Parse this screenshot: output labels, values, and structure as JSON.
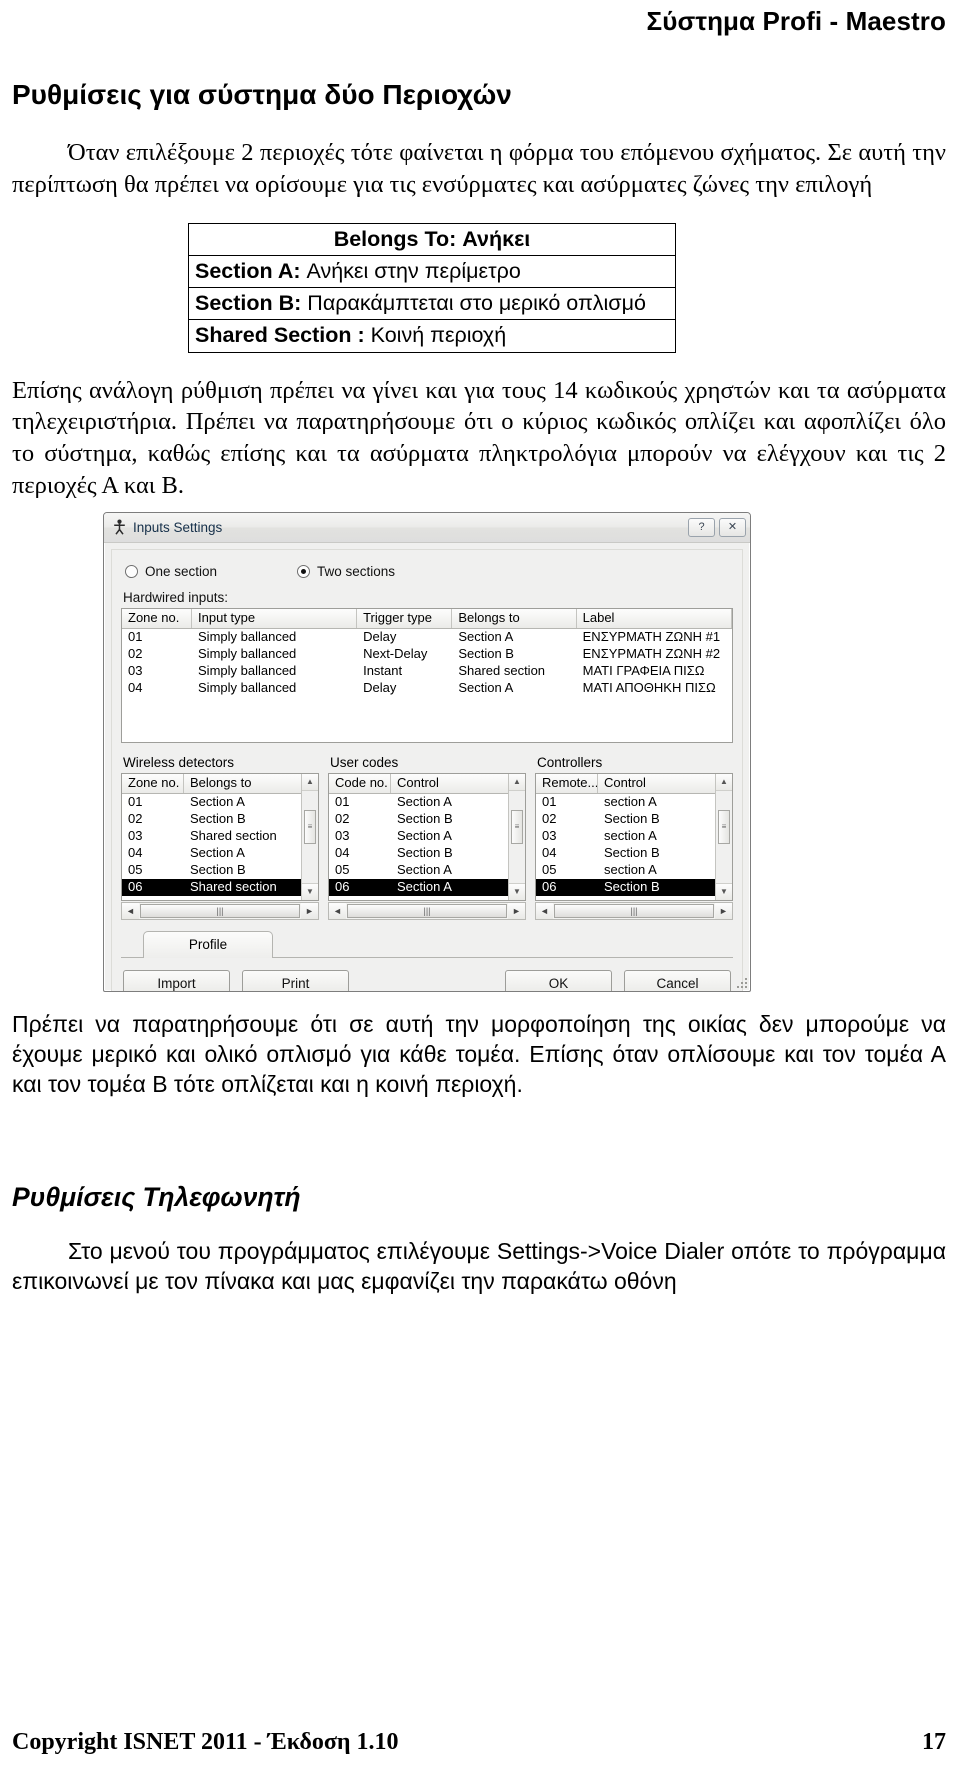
{
  "header": {
    "running_title": "Σύστημα Profi - Maestro"
  },
  "headings": {
    "h1": "Ρυθμίσεις για σύστημα δύο Περιοχών",
    "h2": "Ρυθμίσεις Τηλεφωνητή"
  },
  "paragraphs": {
    "intro": "Όταν  επιλέξουμε 2 περιοχές τότε φαίνεται η φόρμα του επόμενου σχήματος. Σε αυτή την περίπτωση θα πρέπει να ορίσουμε για τις ενσύρματες και ασύρματες ζώνες την επιλογή",
    "after_box": "Επίσης ανάλογη ρύθμιση πρέπει να γίνει και για τους 14 κωδικούς χρηστών και τα ασύρματα τηλεχειριστήρια. Πρέπει να παρατηρήσουμε ότι ο κύριος κωδικός οπλίζει και αφοπλίζει όλο το σύστημα, καθώς επίσης και τα ασύρματα πληκτρολόγια μπορούν να ελέγχουν και τις 2 περιοχές Α και Β.",
    "after_shot": "Πρέπει να παρατηρήσουμε ότι σε αυτή την μορφοποίηση της οικίας δεν μπορούμε να έχουμε μερικό και ολικό οπλισμό για κάθε τομέα. Επίσης όταν οπλίσουμε και τον τομέα Α και τον τομέα Β τότε οπλίζεται και η κοινή περιοχή.",
    "dialer": "Στο μενού του προγράμματος επιλέγουμε Settings->Voice Dialer οπότε το πρόγραμμα επικοινωνεί με τον πίνακα και μας εμφανίζει την παρακάτω οθόνη"
  },
  "belongs_box": {
    "title": "Belongs To: Ανήκει",
    "rows": [
      {
        "key": "Section A:",
        "value": " Ανήκει στην περίμετρο"
      },
      {
        "key": "Section B:",
        "value": " Παρακάμπτεται στο μερικό οπλισμό"
      },
      {
        "key": "Shared Section :",
        "value": " Κοινή περιοχή"
      }
    ]
  },
  "dialog": {
    "title": "Inputs Settings",
    "title_icon": "app-icon",
    "titlebar_buttons": [
      {
        "name": "help-button",
        "glyph": "?"
      },
      {
        "name": "close-button",
        "glyph": "✕"
      }
    ],
    "radios": [
      {
        "label": "One section",
        "selected": false
      },
      {
        "label": "Two sections",
        "selected": true
      }
    ],
    "hardwired_label": "Hardwired inputs:",
    "hardwired_columns": [
      "Zone no.",
      "Input type",
      "Trigger type",
      "Belongs to",
      "Label"
    ],
    "hardwired_rows": [
      [
        "01",
        "Simply ballanced",
        "Delay",
        "Section A",
        "ΕΝΣΥΡΜΑΤΗ ΖΩΝΗ #1"
      ],
      [
        "02",
        "Simply ballanced",
        "Next-Delay",
        "Section B",
        "ΕΝΣΥΡΜΑΤΗ ΖΩΝΗ #2"
      ],
      [
        "03",
        "Simply ballanced",
        "Instant",
        "Shared section",
        "ΜΑΤΙ ΓΡΑΦΕΙΑ ΠΙΣΩ"
      ],
      [
        "04",
        "Simply ballanced",
        "Delay",
        "Section A",
        "ΜΑΤΙ ΑΠΟΘΗΚΗ ΠΙΣΩ"
      ]
    ],
    "lists": [
      {
        "caption": "Wireless detectors",
        "columns": [
          "Zone no.",
          "Belongs to"
        ],
        "rows": [
          [
            "01",
            "Section A",
            false
          ],
          [
            "02",
            "Section B",
            false
          ],
          [
            "03",
            "Shared section",
            false
          ],
          [
            "04",
            "Section A",
            false
          ],
          [
            "05",
            "Section B",
            false
          ],
          [
            "06",
            "Shared section",
            true
          ]
        ],
        "has_vscroll": true
      },
      {
        "caption": "User codes",
        "columns": [
          "Code no.",
          "Control"
        ],
        "rows": [
          [
            "01",
            "Section A",
            false
          ],
          [
            "02",
            "Section B",
            false
          ],
          [
            "03",
            "Section A",
            false
          ],
          [
            "04",
            "Section B",
            false
          ],
          [
            "05",
            "Section A",
            false
          ],
          [
            "06",
            "Section A",
            true
          ]
        ],
        "has_vscroll": true
      },
      {
        "caption": "Controllers",
        "columns": [
          "Remote...",
          "Control"
        ],
        "rows": [
          [
            "01",
            "section A",
            false
          ],
          [
            "02",
            "Section B",
            false
          ],
          [
            "03",
            "section A",
            false
          ],
          [
            "04",
            "Section B",
            false
          ],
          [
            "05",
            "section A",
            false
          ],
          [
            "06",
            "Section B",
            true
          ]
        ],
        "has_vscroll": true
      }
    ],
    "tab": "Profile",
    "buttons": {
      "import": "Import",
      "print": "Print",
      "ok": "OK",
      "cancel": "Cancel"
    }
  },
  "footer": {
    "copyright": "Copyright ISNET 2011 - Έκδοση 1.10",
    "page": "17"
  }
}
